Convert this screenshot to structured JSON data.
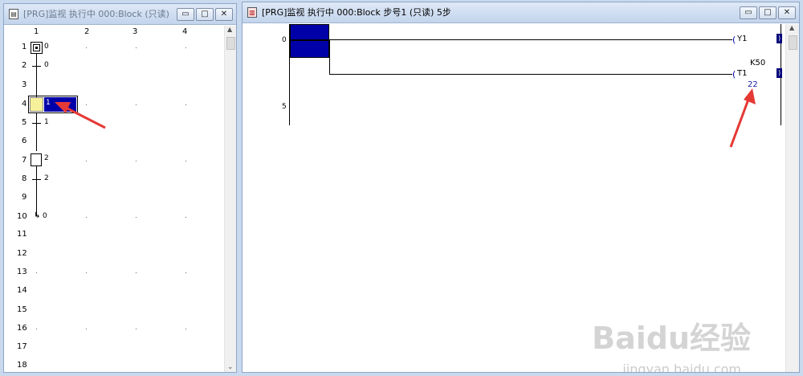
{
  "left_window": {
    "title": "[PRG]监视 执行中 000:Block (只读)",
    "icon": "document-icon",
    "columns": [
      "1",
      "2",
      "3",
      "4"
    ],
    "rows": [
      "1",
      "2",
      "3",
      "4",
      "5",
      "6",
      "7",
      "8",
      "9",
      "10",
      "11",
      "12",
      "13",
      "14",
      "15",
      "16",
      "17",
      "18"
    ],
    "step_labels": {
      "r1": "0",
      "r2": "0",
      "r4": "1",
      "r5": "1",
      "r7": "2",
      "r8": "2",
      "r10": "0"
    },
    "controls": {
      "minimize": "▭",
      "maximize": "□",
      "close": "✕"
    }
  },
  "right_window": {
    "title": "[PRG]监视 执行中 000:Block 步号1 (只读) 5步",
    "icon": "ladder-icon",
    "rung_numbers": [
      "0",
      "5"
    ],
    "coil_y1": "Y1",
    "coil_t1": "T1",
    "timer_setting": "K50",
    "timer_current": "22",
    "controls": {
      "minimize": "▭",
      "maximize": "□",
      "close": "✕"
    }
  },
  "watermark": {
    "brand": "Baidu经验",
    "url": "jingyan.baidu.com"
  },
  "colors": {
    "active_block": "#0000a8",
    "initial_step_fill": "#f7f09a",
    "annotation_arrow": "#e53935"
  }
}
